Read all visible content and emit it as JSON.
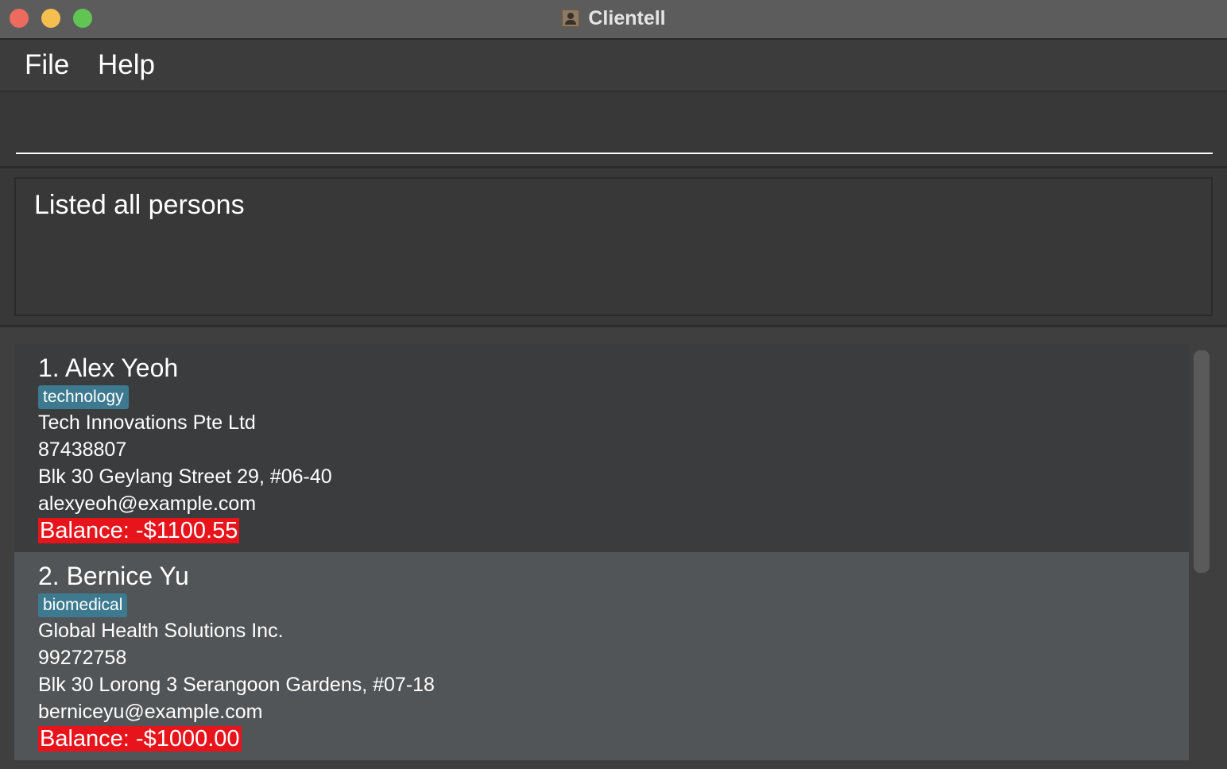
{
  "window": {
    "title": "Clientell"
  },
  "menu": {
    "file": "File",
    "help": "Help"
  },
  "command": {
    "value": "",
    "placeholder": ""
  },
  "result": {
    "message": "Listed all persons"
  },
  "persons": [
    {
      "name": "1. Alex Yeoh",
      "tag": "technology",
      "company": "Tech Innovations Pte Ltd",
      "phone": "87438807",
      "address": "Blk 30 Geylang Street 29, #06-40",
      "email": "alexyeoh@example.com",
      "balance": "Balance: -$1100.55"
    },
    {
      "name": "2. Bernice Yu",
      "tag": "biomedical",
      "company": "Global Health Solutions Inc.",
      "phone": "99272758",
      "address": "Blk 30 Lorong 3 Serangoon Gardens, #07-18",
      "email": "berniceyu@example.com",
      "balance": "Balance: -$1000.00"
    }
  ],
  "colors": {
    "tag_background": "#3d7a90",
    "negative_balance": "#e8141b",
    "selected_card": "#515558"
  }
}
